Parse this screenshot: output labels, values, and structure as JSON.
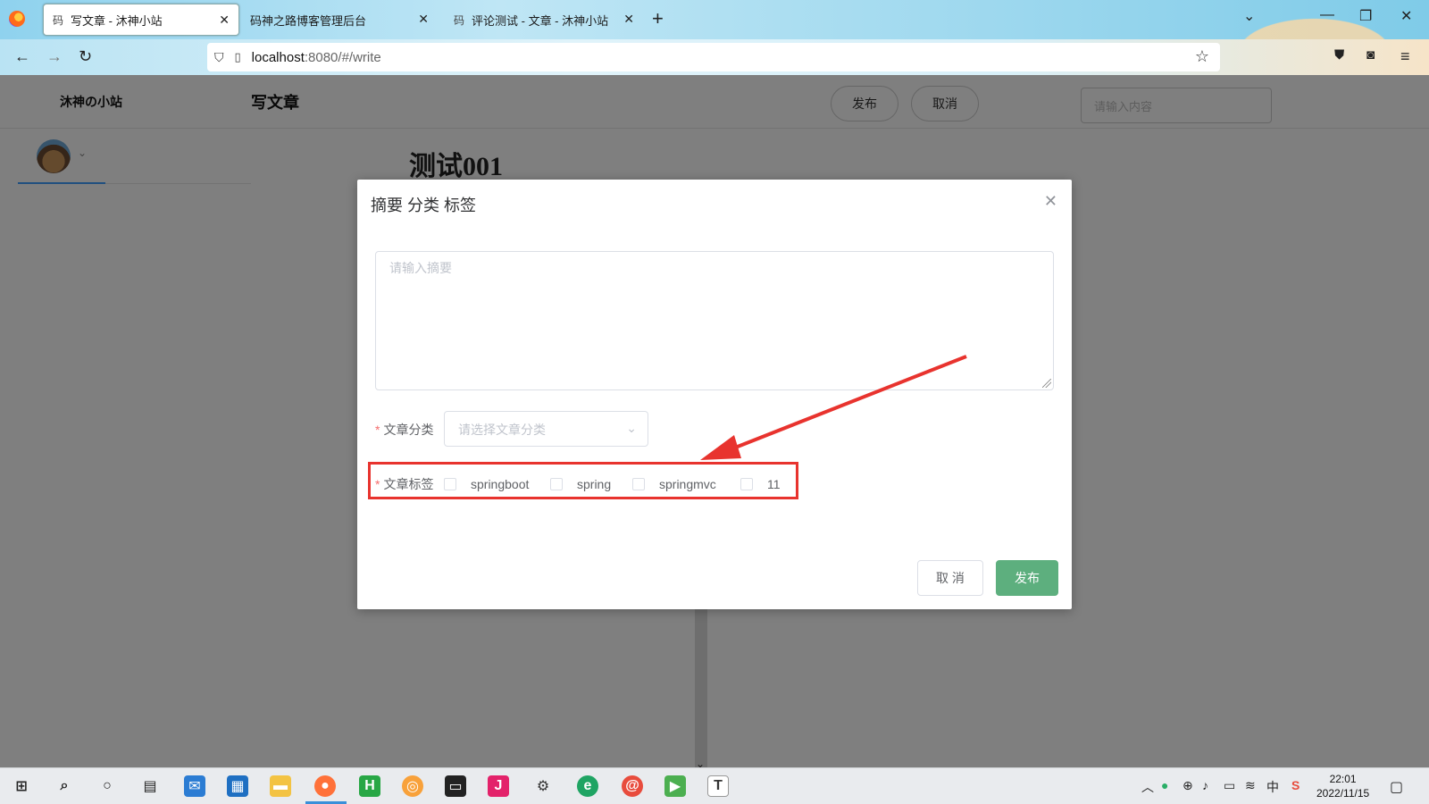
{
  "browser": {
    "tabs": [
      {
        "label": "写文章 - 沐神小站",
        "favicon": "码"
      },
      {
        "label": "码神之路博客管理后台",
        "favicon": ""
      },
      {
        "label": "评论测试 - 文章 - 沐神小站",
        "favicon": "码"
      }
    ],
    "url_host": "localhost",
    "url_path": ":8080/#/write"
  },
  "header": {
    "site_name": "沐神の小站",
    "write_title": "写文章",
    "publish_label": "发布",
    "cancel_label": "取消",
    "search_placeholder": "请输入内容"
  },
  "article": {
    "title": "测试001"
  },
  "dialog": {
    "title": "摘要 分类 标签",
    "summary_placeholder": "请输入摘要",
    "category_label": "文章分类",
    "category_placeholder": "请选择文章分类",
    "tags_label": "文章标签",
    "tags": [
      "springboot",
      "spring",
      "springmvc",
      "11"
    ],
    "cancel_label": "取 消",
    "publish_label": "发布"
  },
  "taskbar": {
    "time": "22:01",
    "date": "2022/11/15",
    "ime": "中"
  },
  "colors": {
    "accent": "#409eff",
    "publish_green": "#5daf7e",
    "highlight_red": "#e8332e",
    "required_red": "#f56c6c"
  }
}
